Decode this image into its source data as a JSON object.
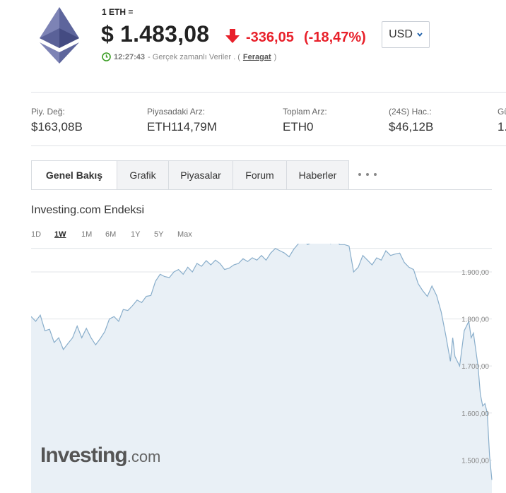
{
  "header": {
    "unit_label": "1 ETH =",
    "price": "$ 1.483,08",
    "change": "-336,05",
    "change_pct": "(-18,47%)",
    "currency": "USD",
    "time": "12:27:43",
    "status_text": "- Gerçek zamanlı Veriler . (",
    "disclaimer": "Feragat",
    "status_close": ")",
    "colors": {
      "negative": "#e8202a",
      "live": "#3a9d23"
    },
    "icons": [
      "ethereum-logo-icon",
      "down-arrow-icon",
      "clock-icon",
      "chevron-down-icon"
    ]
  },
  "stats": [
    {
      "label": "Piy. Değ:",
      "value": "$163,08B"
    },
    {
      "label": "Piyasadaki Arz:",
      "value": "ETH114,79M"
    },
    {
      "label": "Toplam Arz:",
      "value": "ETH0"
    },
    {
      "label": "(24S) Hac.:",
      "value": "$46,12B"
    },
    {
      "label": "Gü",
      "value": "1."
    }
  ],
  "tabs": [
    {
      "label": "Genel Bakış",
      "active": true
    },
    {
      "label": "Grafik"
    },
    {
      "label": "Piyasalar"
    },
    {
      "label": "Forum"
    },
    {
      "label": "Haberler"
    }
  ],
  "index_title": "Investing.com Endeksi",
  "ranges": [
    {
      "label": "1D"
    },
    {
      "label": "1W",
      "active": true
    },
    {
      "label": "1M"
    },
    {
      "label": "6M"
    },
    {
      "label": "1Y"
    },
    {
      "label": "5Y"
    },
    {
      "label": "Max"
    }
  ],
  "watermark": {
    "brand": "Investing",
    "suffix": ".com"
  },
  "chart_data": {
    "type": "area",
    "y_ticks": [
      "1.900,00",
      "1.800,00",
      "1.700,00",
      "1.600,00",
      "1.500,00"
    ],
    "y_tick_values": [
      1900,
      1800,
      1700,
      1600,
      1500
    ],
    "ylim": [
      1430,
      1960
    ],
    "x_range": [
      0,
      1
    ],
    "grid": true,
    "colors": {
      "line": "#89aecb",
      "fill": "#e9f0f6",
      "grid": "#e1e4e8"
    },
    "points": [
      [
        0.0,
        1805
      ],
      [
        0.01,
        1795
      ],
      [
        0.02,
        1808
      ],
      [
        0.03,
        1775
      ],
      [
        0.04,
        1778
      ],
      [
        0.05,
        1750
      ],
      [
        0.06,
        1760
      ],
      [
        0.07,
        1735
      ],
      [
        0.08,
        1748
      ],
      [
        0.09,
        1760
      ],
      [
        0.1,
        1785
      ],
      [
        0.11,
        1760
      ],
      [
        0.12,
        1780
      ],
      [
        0.13,
        1760
      ],
      [
        0.14,
        1745
      ],
      [
        0.15,
        1758
      ],
      [
        0.16,
        1773
      ],
      [
        0.17,
        1800
      ],
      [
        0.18,
        1805
      ],
      [
        0.19,
        1795
      ],
      [
        0.2,
        1820
      ],
      [
        0.21,
        1818
      ],
      [
        0.22,
        1828
      ],
      [
        0.23,
        1840
      ],
      [
        0.24,
        1835
      ],
      [
        0.25,
        1848
      ],
      [
        0.26,
        1850
      ],
      [
        0.27,
        1880
      ],
      [
        0.28,
        1895
      ],
      [
        0.29,
        1890
      ],
      [
        0.3,
        1888
      ],
      [
        0.31,
        1900
      ],
      [
        0.32,
        1905
      ],
      [
        0.33,
        1895
      ],
      [
        0.34,
        1910
      ],
      [
        0.35,
        1900
      ],
      [
        0.36,
        1918
      ],
      [
        0.37,
        1912
      ],
      [
        0.38,
        1924
      ],
      [
        0.39,
        1915
      ],
      [
        0.4,
        1925
      ],
      [
        0.41,
        1918
      ],
      [
        0.42,
        1905
      ],
      [
        0.43,
        1908
      ],
      [
        0.44,
        1915
      ],
      [
        0.45,
        1918
      ],
      [
        0.46,
        1928
      ],
      [
        0.47,
        1922
      ],
      [
        0.48,
        1930
      ],
      [
        0.49,
        1925
      ],
      [
        0.5,
        1935
      ],
      [
        0.51,
        1925
      ],
      [
        0.52,
        1940
      ],
      [
        0.53,
        1950
      ],
      [
        0.54,
        1945
      ],
      [
        0.55,
        1940
      ],
      [
        0.56,
        1932
      ],
      [
        0.57,
        1948
      ],
      [
        0.58,
        1960
      ],
      [
        0.59,
        1970
      ],
      [
        0.6,
        1958
      ],
      [
        0.61,
        1963
      ],
      [
        0.62,
        1975
      ],
      [
        0.63,
        1968
      ],
      [
        0.64,
        1978
      ],
      [
        0.65,
        1960
      ],
      [
        0.66,
        1968
      ],
      [
        0.67,
        1958
      ],
      [
        0.68,
        1958
      ],
      [
        0.69,
        1955
      ],
      [
        0.7,
        1900
      ],
      [
        0.71,
        1910
      ],
      [
        0.72,
        1935
      ],
      [
        0.73,
        1925
      ],
      [
        0.74,
        1915
      ],
      [
        0.75,
        1930
      ],
      [
        0.76,
        1925
      ],
      [
        0.77,
        1945
      ],
      [
        0.78,
        1935
      ],
      [
        0.79,
        1938
      ],
      [
        0.8,
        1940
      ],
      [
        0.81,
        1920
      ],
      [
        0.82,
        1910
      ],
      [
        0.83,
        1905
      ],
      [
        0.84,
        1875
      ],
      [
        0.85,
        1860
      ],
      [
        0.86,
        1848
      ],
      [
        0.87,
        1870
      ],
      [
        0.88,
        1850
      ],
      [
        0.89,
        1815
      ],
      [
        0.9,
        1765
      ],
      [
        0.91,
        1710
      ],
      [
        0.915,
        1760
      ],
      [
        0.92,
        1720
      ],
      [
        0.93,
        1700
      ],
      [
        0.94,
        1775
      ],
      [
        0.95,
        1795
      ],
      [
        0.955,
        1760
      ],
      [
        0.96,
        1770
      ],
      [
        0.97,
        1700
      ],
      [
        0.975,
        1640
      ],
      [
        0.98,
        1615
      ],
      [
        0.985,
        1620
      ],
      [
        0.99,
        1600
      ],
      [
        0.995,
        1510
      ],
      [
        1.0,
        1458
      ]
    ]
  }
}
